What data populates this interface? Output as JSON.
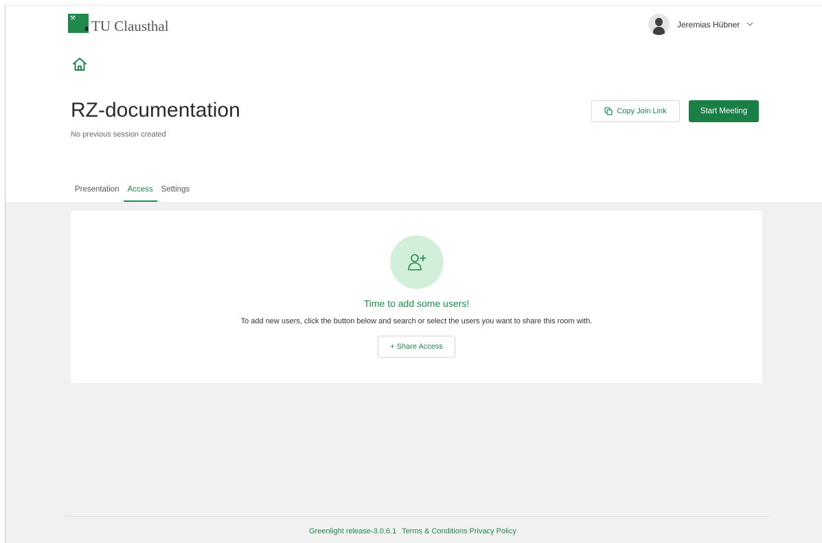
{
  "brand": {
    "logo_text": "TU Clausthal",
    "accent_color": "#1f8a4c"
  },
  "user": {
    "name": "Jeremias Hübner",
    "avatar_icon": "user-silhouette-icon"
  },
  "nav": {
    "home_icon": "home-icon"
  },
  "room": {
    "title": "RZ-documentation",
    "subtitle": "No previous session created",
    "copy_link_label": "Copy Join Link",
    "start_meeting_label": "Start Meeting"
  },
  "tabs": [
    {
      "label": "Presentation",
      "active": false
    },
    {
      "label": "Access",
      "active": true
    },
    {
      "label": "Settings",
      "active": false
    }
  ],
  "access_panel": {
    "icon": "add-user-icon",
    "title": "Time to add some users!",
    "description": "To add new users, click the button below and search or select the users you want to share this room with.",
    "share_button_label": "+ Share Access"
  },
  "footer": {
    "release": "Greenlight release-3.0.6.1",
    "terms": "Terms & Conditions",
    "privacy": "Privacy Policy"
  }
}
